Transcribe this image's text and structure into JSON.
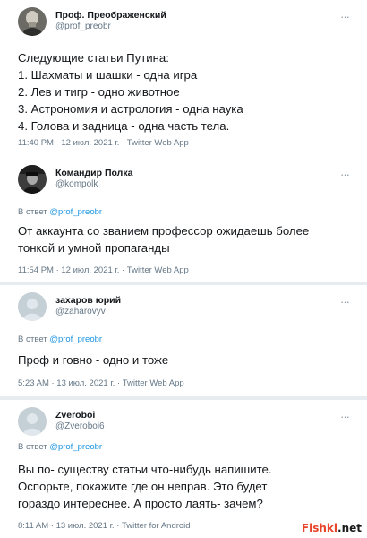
{
  "tweets": [
    {
      "name": "Проф. Преображенский",
      "handle": "@prof_preobr",
      "reply_to": null,
      "lines": [
        "Следующие статьи Путина:",
        "1. Шахматы и шашки - одна игра",
        "2. Лев и тигр - одно животное",
        "3. Астрономия и астрология - одна наука",
        "4. Голова и задница - одна часть тела."
      ],
      "meta": "11:40 PM · 12 июл. 2021 г. · Twitter Web App"
    },
    {
      "name": "Командир Полка",
      "handle": "@kompolk",
      "reply_prefix": "В ответ ",
      "reply_to": "@prof_preobr",
      "lines": [
        "От аккаунта со званием профессор ожидаешь более",
        "тонкой и умной пропаганды"
      ],
      "meta": "11:54 PM · 12 июл. 2021 г. · Twitter Web App"
    },
    {
      "name": "захаров юрий",
      "handle": "@zaharovyv",
      "reply_prefix": "В ответ ",
      "reply_to": "@prof_preobr",
      "lines": [
        "Проф и говно - одно и тоже"
      ],
      "meta": "5:23 AM · 13 июл. 2021 г. · Twitter Web App"
    },
    {
      "name": "Zveroboi",
      "handle": "@Zveroboi6",
      "reply_prefix": "В ответ ",
      "reply_to": "@prof_preobr",
      "lines": [
        "Вы по- существу статьи что-нибудь напишите.",
        "Оспорьте, покажите где он неправ. Это будет",
        "гораздо интереснее. А просто лаять- зачем?"
      ],
      "meta": "8:11 AM · 13 июл. 2021 г. · Twitter for Android"
    }
  ],
  "more_label": "···",
  "watermark": {
    "prefix": "Fishki",
    "suffix": ".net"
  },
  "icons": {
    "more": "more-icon",
    "avatar_default": "default-avatar-icon"
  },
  "colors": {
    "background": "#e6ecf0",
    "link": "#1b95e0",
    "muted": "#657786"
  }
}
